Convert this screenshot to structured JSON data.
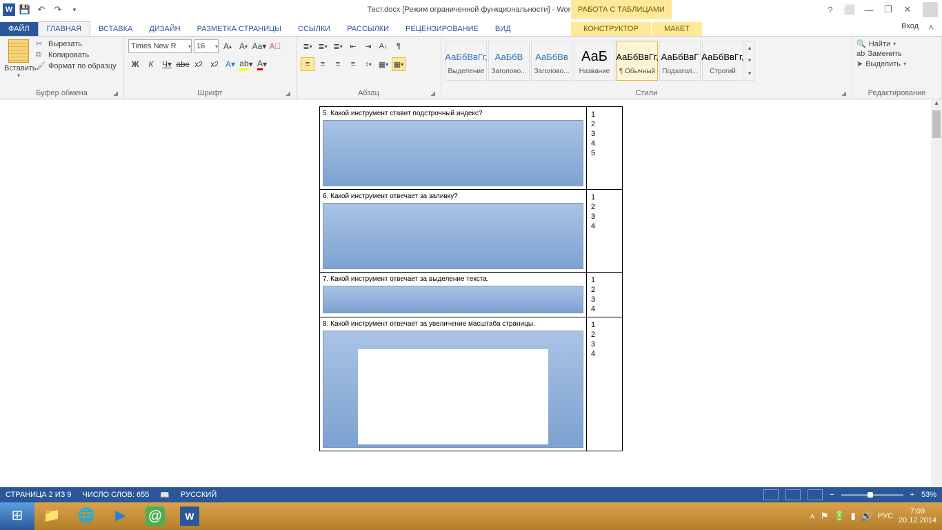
{
  "title_doc": "Тест.docx [Режим ограниченной функциональности] - Word",
  "tools_context": "РАБОТА С ТАБЛИЦАМИ",
  "tabs": {
    "file": "ФАЙЛ",
    "home": "ГЛАВНАЯ",
    "insert": "ВСТАВКА",
    "design": "ДИЗАЙН",
    "layout": "РАЗМЕТКА СТРАНИЦЫ",
    "refs": "ССЫЛКИ",
    "mail": "РАССЫЛКИ",
    "review": "РЕЦЕНЗИРОВАНИЕ",
    "view": "ВИД",
    "ctx1": "КОНСТРУКТОР",
    "ctx2": "МАКЕТ",
    "login": "Вход"
  },
  "clipboard": {
    "paste": "Вставить",
    "cut": "Вырезать",
    "copy": "Копировать",
    "painter": "Формат по образцу",
    "group": "Буфер обмена"
  },
  "font": {
    "name": "Times New R",
    "size": "16",
    "group": "Шрифт"
  },
  "para": {
    "group": "Абзац"
  },
  "styles": {
    "group": "Стили",
    "items": [
      {
        "sample": "АаБбВвГг,",
        "label": "Выделение",
        "blue": true,
        "big": false
      },
      {
        "sample": "АаБбВ",
        "label": "Заголово...",
        "blue": true,
        "big": false
      },
      {
        "sample": "АаБбВв",
        "label": "Заголово...",
        "blue": true,
        "big": false
      },
      {
        "sample": "АаБ",
        "label": "Название",
        "blue": false,
        "big": true
      },
      {
        "sample": "АаБбВвГг,",
        "label": "¶ Обычный",
        "blue": false,
        "big": false
      },
      {
        "sample": "АаБбВвГ",
        "label": "Подзагол...",
        "blue": false,
        "big": false
      },
      {
        "sample": "АаБбВвГг,",
        "label": "Строгий",
        "blue": false,
        "big": false
      }
    ],
    "selected": 4
  },
  "editing": {
    "find": "Найти",
    "replace": "Заменить",
    "select": "Выделить",
    "group": "Редактирование"
  },
  "doc": {
    "q5": "5. Какой инструмент ставит подстрочный индекс?",
    "a5": "1\n2\n3\n4\n5",
    "q6": "6. Какой инструмент отвечает за заливку?",
    "a6": "1\n2\n3\n4",
    "q7": "7. Какой инструмент отвечает за выделение текста.",
    "a7": "1\n2\n3\n4",
    "q8": "8. Какой инструмент отвечает за увеличение масштаба страницы.",
    "a8": "1\n2\n3\n4"
  },
  "status": {
    "page": "СТРАНИЦА 2 ИЗ 9",
    "words": "ЧИСЛО СЛОВ: 655",
    "lang": "РУССКИЙ",
    "zoom": "53%"
  },
  "tray": {
    "lang": "РУС",
    "time": "7:09",
    "date": "20.12.2014"
  }
}
